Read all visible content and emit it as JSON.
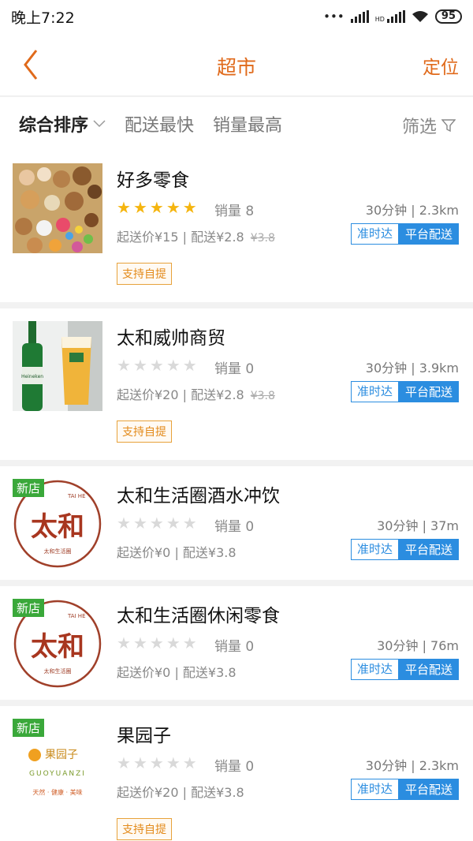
{
  "status_bar": {
    "time": "晚上7:22",
    "hd": "HD",
    "battery": "95"
  },
  "header": {
    "title": "超市",
    "right_action": "定位"
  },
  "sort_bar": {
    "items": [
      "综合排序",
      "配送最快",
      "销量最高"
    ],
    "filter_label": "筛选"
  },
  "stores": [
    {
      "name": "好多零食",
      "rating": 5,
      "sales": "销量 8",
      "eta": "30分钟 | 2.3km",
      "fees": "起送价¥15 | 配送¥2.8",
      "old_fee": "¥3.8",
      "tag_ontime": "准时达",
      "tag_platform": "平台配送",
      "pickup": "支持自提",
      "is_new": false
    },
    {
      "name": "太和威帅商贸",
      "rating": 0,
      "sales": "销量 0",
      "eta": "30分钟 | 3.9km",
      "fees": "起送价¥20 | 配送¥2.8",
      "old_fee": "¥3.8",
      "tag_ontime": "准时达",
      "tag_platform": "平台配送",
      "pickup": "支持自提",
      "is_new": false,
      "thumb_text": "Heineken"
    },
    {
      "name": "太和生活圈酒水冲饮",
      "rating": 0,
      "sales": "销量 0",
      "eta": "30分钟 | 37m",
      "fees": "起送价¥0 | 配送¥3.8",
      "tag_ontime": "准时达",
      "tag_platform": "平台配送",
      "is_new": true,
      "new_label": "新店",
      "logo_text": {
        "latin": "TAI HE",
        "main": "太和",
        "sub": "太和生活圈"
      }
    },
    {
      "name": "太和生活圈休闲零食",
      "rating": 0,
      "sales": "销量 0",
      "eta": "30分钟 | 76m",
      "fees": "起送价¥0 | 配送¥3.8",
      "tag_ontime": "准时达",
      "tag_platform": "平台配送",
      "is_new": true,
      "new_label": "新店",
      "logo_text": {
        "latin": "TAI HE",
        "main": "太和",
        "sub": "太和生活圈"
      }
    },
    {
      "name": "果园子",
      "rating": 0,
      "sales": "销量 0",
      "eta": "30分钟 | 2.3km",
      "fees": "起送价¥20 | 配送¥3.8",
      "tag_ontime": "准时达",
      "tag_platform": "平台配送",
      "pickup": "支持自提",
      "is_new": true,
      "new_label": "新店",
      "logo_text": {
        "main": "果园子",
        "latin": "GUOYUANZI",
        "sub": "天然 · 健康 · 美味"
      }
    }
  ],
  "icons": {
    "back": "back-arrow-icon",
    "chevron": "chevron-down-icon",
    "filter": "funnel-icon",
    "star_on": "star-filled-icon",
    "star_off": "star-empty-icon"
  },
  "colors": {
    "accent": "#e06a1b",
    "blue": "#2b8de0",
    "star": "#f5b50f",
    "new_badge": "#3aa83a"
  }
}
